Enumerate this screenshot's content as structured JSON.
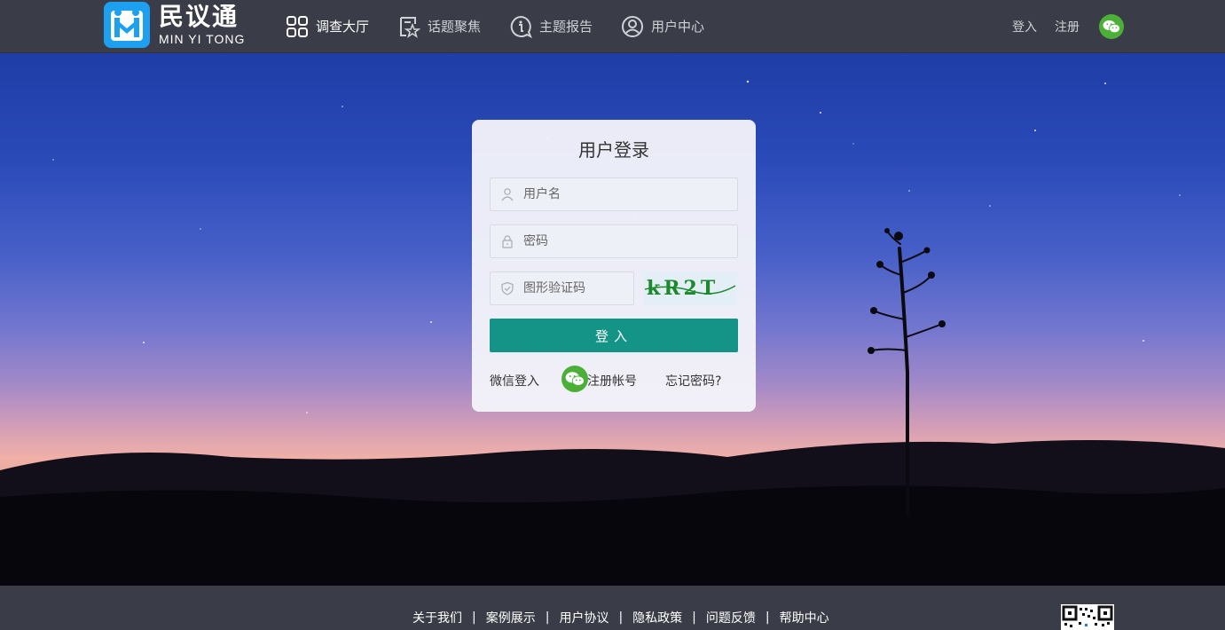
{
  "header": {
    "logo": {
      "cn": "民议通",
      "en": "MIN YI TONG"
    },
    "nav": [
      {
        "label": "调查大厅",
        "icon": "grid-icon",
        "active": true
      },
      {
        "label": "话题聚焦",
        "icon": "star-document-icon",
        "active": false
      },
      {
        "label": "主题报告",
        "icon": "info-bubble-icon",
        "active": false
      },
      {
        "label": "用户中心",
        "icon": "user-circle-icon",
        "active": false
      }
    ],
    "login_label": "登入",
    "register_label": "注册",
    "wechat_icon": "wechat-icon"
  },
  "login": {
    "title": "用户登录",
    "username_placeholder": "用户名",
    "password_placeholder": "密码",
    "captcha_placeholder": "图形验证码",
    "captcha_text": "kR2T",
    "submit_label": "登入",
    "wechat_login_label": "微信登入",
    "register_label": "注册帐号",
    "forgot_label": "忘记密码?"
  },
  "footer": {
    "links": [
      "关于我们",
      "案例展示",
      "用户协议",
      "隐私政策",
      "问题反馈",
      "帮助中心"
    ],
    "separator": "|"
  },
  "colors": {
    "header_bg": "#3a3d47",
    "primary_button": "#139486",
    "wechat_green": "#4caf37",
    "logo_blue": "#1ea0f0"
  }
}
